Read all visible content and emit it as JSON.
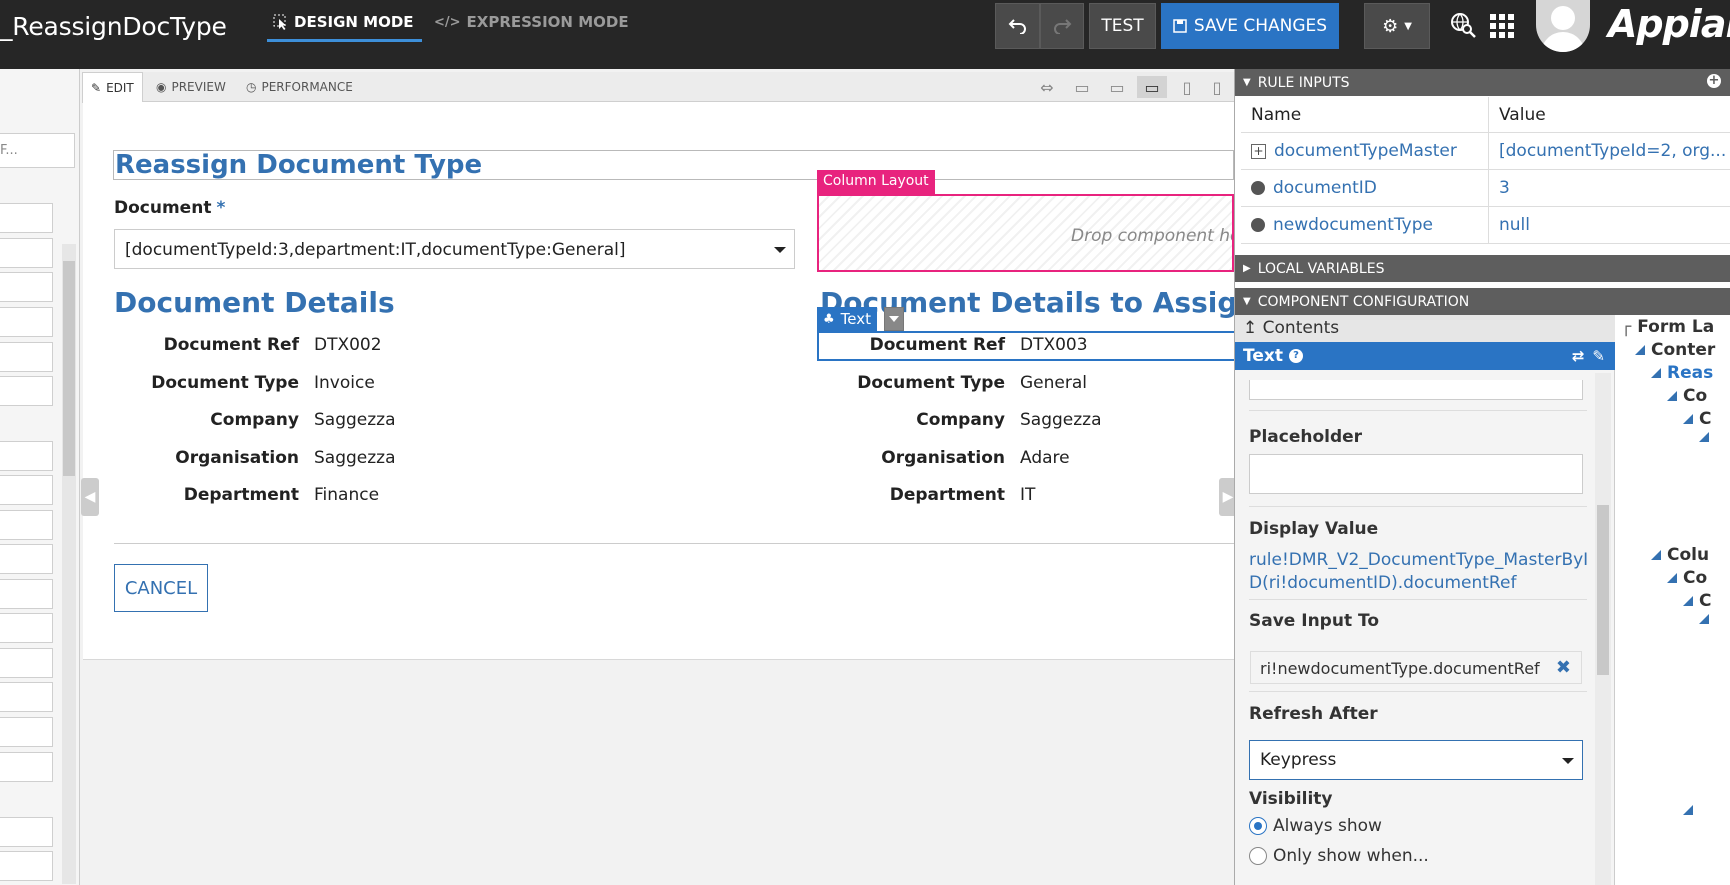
{
  "header": {
    "title": "_ReassignDocType",
    "design_mode": "DESIGN MODE",
    "expression_mode": "EXPRESSION MODE",
    "test_label": "TEST",
    "save_label": "SAVE CHANGES",
    "logo_text": "Appian"
  },
  "edit_tabs": {
    "edit": "EDIT",
    "preview": "PREVIEW",
    "performance": "PERFORMANCE"
  },
  "form": {
    "title": "Reassign Document Type",
    "document_label": "Document",
    "document_required": "*",
    "document_value": "[documentTypeId:3,department:IT,documentType:General]",
    "column_layout_tag": "Column Layout",
    "drop_hint": "Drop component here",
    "text_tag": "Text",
    "cancel_label": "CANCEL",
    "left_section": {
      "title": "Document Details",
      "rows": [
        {
          "label": "Document Ref",
          "value": "DTX002"
        },
        {
          "label": "Document Type",
          "value": "Invoice"
        },
        {
          "label": "Company",
          "value": "Saggezza"
        },
        {
          "label": "Organisation",
          "value": "Saggezza"
        },
        {
          "label": "Department",
          "value": "Finance"
        }
      ]
    },
    "right_section": {
      "title": "Document Details to Assign",
      "rows": [
        {
          "label": "Document Ref",
          "value": "DTX003"
        },
        {
          "label": "Document Type",
          "value": "General"
        },
        {
          "label": "Company",
          "value": "Saggezza"
        },
        {
          "label": "Organisation",
          "value": "Adare"
        },
        {
          "label": "Department",
          "value": "IT"
        }
      ]
    }
  },
  "left_panel": {
    "search_placeholder": "F..."
  },
  "rule_inputs": {
    "header": "RULE INPUTS",
    "col_name": "Name",
    "col_value": "Value",
    "rows": [
      {
        "name": "documentTypeMaster",
        "value": "[documentTypeId=2, org..."
      },
      {
        "name": "documentID",
        "value": "3"
      },
      {
        "name": "newdocumentType",
        "value": "null"
      }
    ]
  },
  "local_variables": {
    "header": "LOCAL VARIABLES"
  },
  "component_config": {
    "header": "COMPONENT CONFIGURATION",
    "contents_label": "Contents",
    "selected_label": "Text",
    "placeholder_label": "Placeholder",
    "display_value_label": "Display Value",
    "display_value": "rule!DMR_V2_DocumentType_MasterByID(ri!documentID).documentRef",
    "save_input_label": "Save Input To",
    "save_input_value": "ri!newdocumentType.documentRef",
    "refresh_after_label": "Refresh After",
    "refresh_after_value": "Keypress",
    "visibility_label": "Visibility",
    "visibility_options": [
      "Always show",
      "Only show when..."
    ]
  },
  "tree": {
    "items": [
      "Form La",
      "Conter",
      "Reas",
      "Co",
      "C",
      "Colu",
      "Co",
      "C"
    ]
  }
}
